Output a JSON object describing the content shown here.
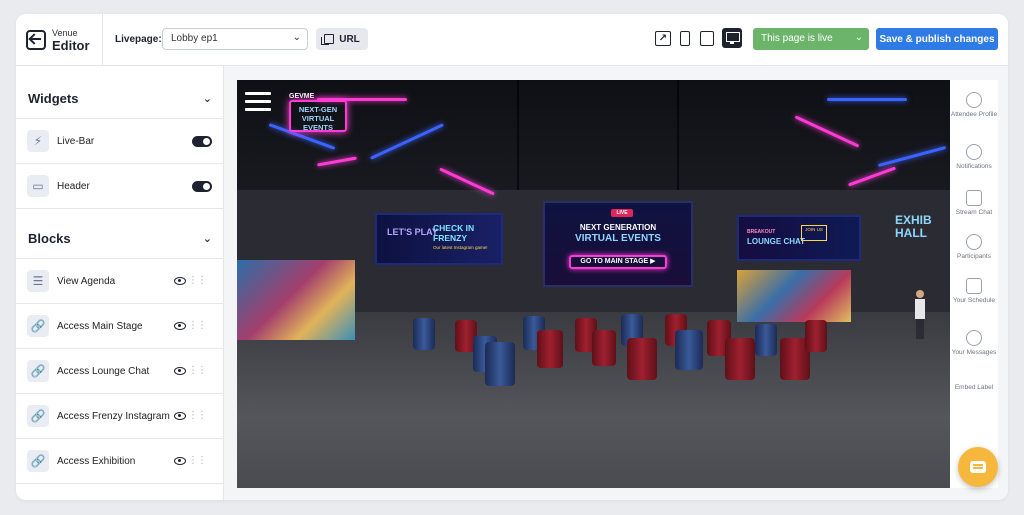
{
  "brand": {
    "sup": "Venue",
    "main": "Editor"
  },
  "header": {
    "livepage_label": "Livepage:",
    "livepage_value": "Lobby ep1",
    "url_label": "URL",
    "status_value": "This page is live",
    "publish_label": "Save & publish changes"
  },
  "sidebar": {
    "widgets_title": "Widgets",
    "widgets": [
      {
        "label": "Live-Bar",
        "icon": "lightning-icon",
        "enabled": true
      },
      {
        "label": "Header",
        "icon": "header-icon",
        "enabled": true
      }
    ],
    "blocks_title": "Blocks",
    "blocks": [
      {
        "label": "View Agenda",
        "icon": "list-icon"
      },
      {
        "label": "Access Main Stage",
        "icon": "link-icon"
      },
      {
        "label": "Access Lounge Chat",
        "icon": "link-icon"
      },
      {
        "label": "Access Frenzy Instagram",
        "icon": "link-icon"
      },
      {
        "label": "Access Exhibition",
        "icon": "link-icon"
      }
    ]
  },
  "preview": {
    "logo_text": "GEVME",
    "sign_top_left": "NEXT-GEN VIRTUAL EVENTS",
    "main_live": "LIVE",
    "main_title1": "NEXT GENERATION",
    "main_title2": "VIRTUAL EVENTS",
    "main_button": "GO TO MAIN STAGE ▶",
    "left_play": "LET'S PLAY",
    "left_title": "CHECK IN FRENZY",
    "left_sub": "Our latest Instagram game!",
    "right_small": "BREAKOUT",
    "right_title": "LOUNGE CHAT",
    "right_join": "JOIN US",
    "far_right": "EXHIB HALL"
  },
  "rail": [
    {
      "label": "Attendee Profile",
      "icon": "user-icon"
    },
    {
      "label": "Notifications",
      "icon": "bell-icon"
    },
    {
      "label": "Stream Chat",
      "icon": "chat-icon"
    },
    {
      "label": "Participants",
      "icon": "people-icon"
    },
    {
      "label": "Your Schedule",
      "icon": "calendar-icon"
    },
    {
      "label": "Your Messages",
      "icon": "send-icon"
    },
    {
      "label": "Embed Label",
      "icon": ""
    }
  ],
  "colors": {
    "accent_blue": "#2e7be6",
    "live_green": "#6db46b",
    "fab_yellow": "#f5b83c"
  }
}
